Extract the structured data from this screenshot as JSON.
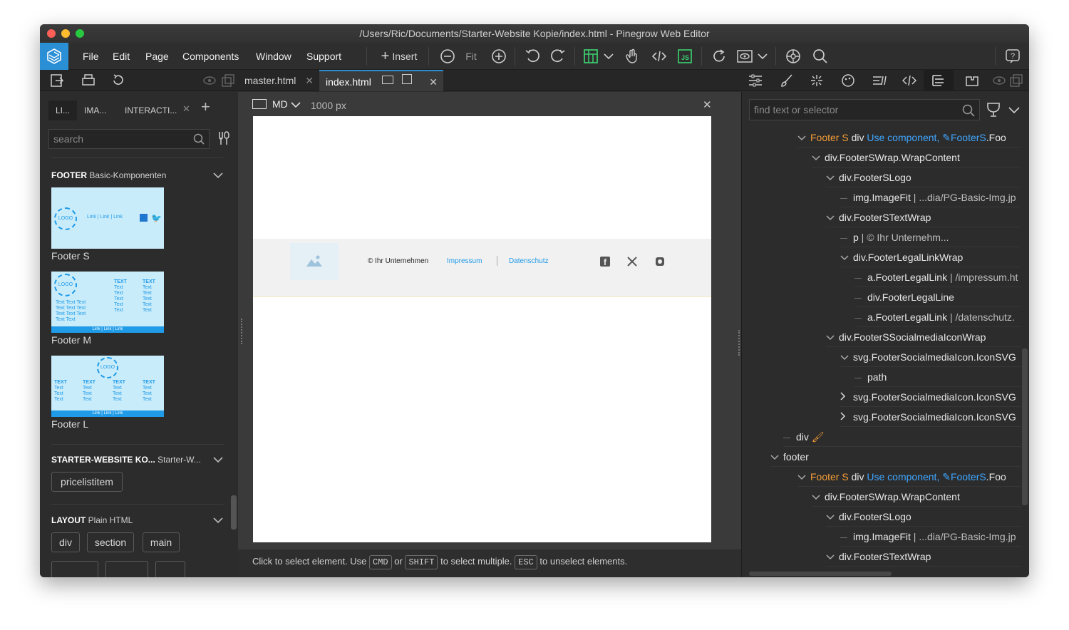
{
  "window": {
    "title": "/Users/Ric/Documents/Starter-Website Kopie/index.html - Pinegrow Web Editor"
  },
  "menu": [
    "File",
    "Edit",
    "Page",
    "Components",
    "Window",
    "Support"
  ],
  "toolbar": {
    "insert_label": "Insert",
    "fit_label": "Fit"
  },
  "tabs": [
    {
      "label": "master.html"
    },
    {
      "label": "index.html"
    }
  ],
  "left": {
    "tabs": [
      "LI...",
      "IMA...",
      "INTERACTI..."
    ],
    "search_placeholder": "search",
    "footer_section": {
      "title": "FOOTER",
      "sub": "Basic-Komponenten",
      "items": [
        "Footer S",
        "Footer M",
        "Footer L"
      ]
    },
    "starter_section": {
      "title": "STARTER-WEBSITE KO...",
      "sub": "Starter-W...",
      "chip": "pricelistitem"
    },
    "layout_section": {
      "title": "LAYOUT",
      "sub": "Plain HTML",
      "chips": [
        "div",
        "section",
        "main"
      ]
    }
  },
  "canvas": {
    "device": "MD",
    "width_label": "1000 px",
    "footer": {
      "copyright": "© Ihr Unternehmen",
      "link1": "Impressum",
      "link2": "Datenschutz"
    },
    "status": {
      "p1": "Click to select element. Use",
      "k1": "CMD",
      "p2": "or",
      "k2": "SHIFT",
      "p3": "to select multiple.",
      "k3": "ESC",
      "p4": "to unselect elements."
    }
  },
  "thumbs": {
    "logo": "LOGO",
    "links": "Link | Link | Link",
    "text_head": "TEXT",
    "text": "Text"
  },
  "right": {
    "search_placeholder": "find text or selector",
    "tree": [
      {
        "indent": 0,
        "type": "comp",
        "name": "Footer S",
        "tag": "div",
        "action": "Use component,",
        "ref": "FooterS",
        "extra": ".Foo"
      },
      {
        "indent": 1,
        "type": "open",
        "text": "div.FooterSWrap.WrapContent"
      },
      {
        "indent": 2,
        "type": "open",
        "text": "div.FooterSLogo"
      },
      {
        "indent": 3,
        "type": "leaf",
        "text": "img.ImageFit",
        "dim": " | ...dia/PG-Basic-Img.jp"
      },
      {
        "indent": 2,
        "type": "open",
        "text": "div.FooterSTextWrap"
      },
      {
        "indent": 3,
        "type": "leaf",
        "text": "p",
        "dim": " | © Ihr Unternehm..."
      },
      {
        "indent": 3,
        "type": "open",
        "text": "div.FooterLegalLinkWrap"
      },
      {
        "indent": 4,
        "type": "leaf",
        "text": "a.FooterLegalLink",
        "dim": " | /impressum.ht"
      },
      {
        "indent": 4,
        "type": "leaf",
        "text": "div.FooterLegalLine",
        "dim": ""
      },
      {
        "indent": 4,
        "type": "leaf",
        "text": "a.FooterLegalLink",
        "dim": " | /datenschutz."
      },
      {
        "indent": 2,
        "type": "open",
        "text": "div.FooterSSocialmediaIconWrap"
      },
      {
        "indent": 3,
        "type": "open",
        "text": "svg.FooterSocialmediaIcon.IconSVG"
      },
      {
        "indent": 4,
        "type": "leaf",
        "text": "path",
        "dim": ""
      },
      {
        "indent": 3,
        "type": "closed",
        "text": "svg.FooterSocialmediaIcon.IconSVG"
      },
      {
        "indent": 3,
        "type": "closed",
        "text": "svg.FooterSocialmediaIcon.IconSVG"
      },
      {
        "indent": -1,
        "type": "leafbrush",
        "text": "div"
      },
      {
        "indent": -1.9,
        "type": "open",
        "text": "footer"
      },
      {
        "indent": 0,
        "type": "comp",
        "name": "Footer S",
        "tag": "div",
        "action": "Use component,",
        "ref": "FooterS",
        "extra": ".Foo"
      },
      {
        "indent": 1,
        "type": "open",
        "text": "div.FooterSWrap.WrapContent"
      },
      {
        "indent": 2,
        "type": "open",
        "text": "div.FooterSLogo"
      },
      {
        "indent": 3,
        "type": "leaf",
        "text": "img.ImageFit",
        "dim": " | ...dia/PG-Basic-Img.jp"
      },
      {
        "indent": 2,
        "type": "open",
        "text": "div.FooterSTextWrap"
      }
    ]
  },
  "colors": {
    "accent": "#2b8fd6",
    "component": "#f39c36",
    "link": "#3ea6ff",
    "thumb_bg": "#c9ecfb",
    "thumb_bar": "#1f9be8"
  }
}
